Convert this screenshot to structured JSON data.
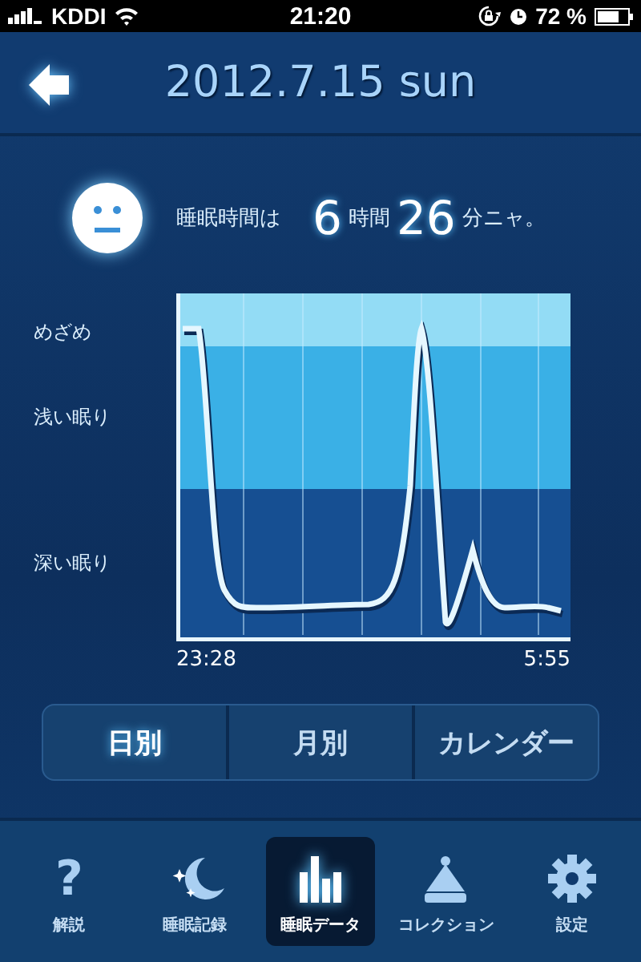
{
  "status_bar": {
    "carrier": "KDDI",
    "time": "21:20",
    "battery_percent": "72 %"
  },
  "header": {
    "title": "2012.7.15 sun"
  },
  "summary": {
    "label": "睡眠時間は",
    "hours": "6",
    "hours_unit": "時間",
    "minutes": "26",
    "minutes_unit": "分ニャ。"
  },
  "chart": {
    "stages": [
      {
        "label": "めざめ"
      },
      {
        "label": "浅い眠り"
      },
      {
        "label": "深い眠り"
      }
    ],
    "start_time": "23:28",
    "end_time": "5:55"
  },
  "segments": [
    {
      "label": "日別",
      "selected": true
    },
    {
      "label": "月別",
      "selected": false
    },
    {
      "label": "カレンダー",
      "selected": false
    }
  ],
  "tab_bar": [
    {
      "kind": "help",
      "glyph": "?",
      "label": "解説",
      "selected": false
    },
    {
      "kind": "moon",
      "label": "睡眠記録",
      "selected": false
    },
    {
      "kind": "bars",
      "label": "睡眠データ",
      "selected": true
    },
    {
      "kind": "cap",
      "label": "コレクション",
      "selected": false
    },
    {
      "kind": "gear",
      "label": "設定",
      "selected": false
    }
  ]
}
